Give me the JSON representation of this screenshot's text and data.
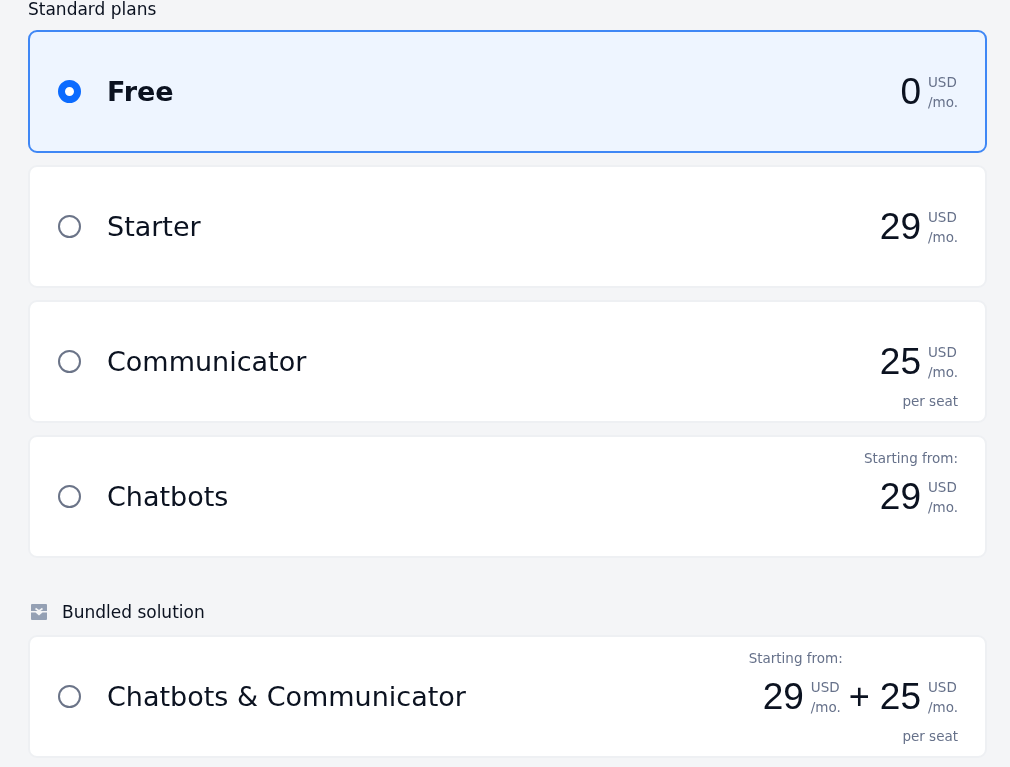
{
  "sections": [
    {
      "kind": "standard",
      "title": "Standard plans",
      "plans": [
        {
          "name": "Free",
          "selected": true,
          "prices": [
            {
              "amount": "0",
              "currency": "USD",
              "period": "/mo."
            }
          ]
        },
        {
          "name": "Starter",
          "selected": false,
          "prices": [
            {
              "amount": "29",
              "currency": "USD",
              "period": "/mo."
            }
          ]
        },
        {
          "name": "Communicator",
          "selected": false,
          "prices": [
            {
              "amount": "25",
              "currency": "USD",
              "period": "/mo."
            }
          ],
          "note": "per seat"
        },
        {
          "name": "Chatbots",
          "selected": false,
          "starting_label": "Starting from:",
          "prices": [
            {
              "amount": "29",
              "currency": "USD",
              "period": "/mo."
            }
          ]
        }
      ]
    },
    {
      "kind": "bundle",
      "title": "Bundled solution",
      "plans": [
        {
          "name": "Chatbots & Communicator",
          "selected": false,
          "starting_label": "Starting from:",
          "prices": [
            {
              "amount": "29",
              "currency": "USD",
              "period": "/mo."
            },
            {
              "amount": "25",
              "currency": "USD",
              "period": "/mo."
            }
          ],
          "joiner": "+",
          "note": "per seat"
        }
      ]
    }
  ]
}
